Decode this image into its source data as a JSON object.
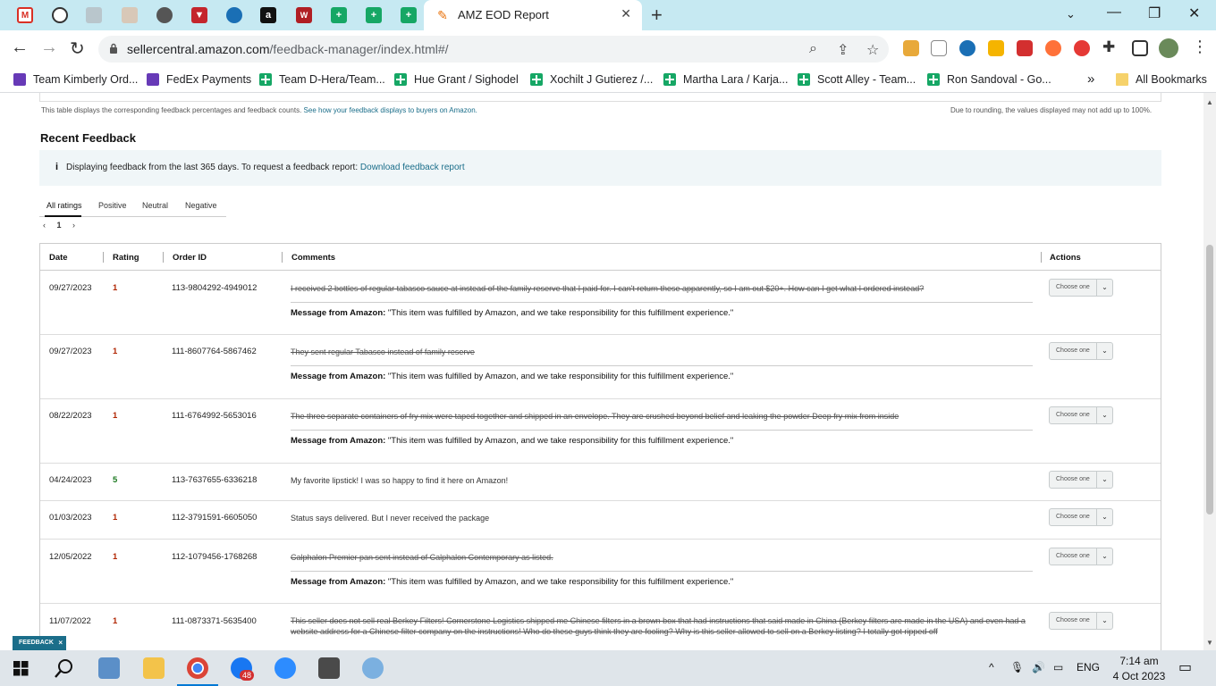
{
  "browser": {
    "active_tab_title": "AMZ EOD Report",
    "url_host": "sellercentral.amazon.com",
    "url_path": "/feedback-manager/index.html#/",
    "bookmarks": [
      "Team Kimberly Ord...",
      "FedEx Payments",
      "Team D-Hera/Team...",
      "Hue Grant / Sighodel",
      "Xochilt J Gutierez /...",
      "Martha Lara / Karja...",
      "Scott Alley - Team...",
      "Ron Sandoval - Go..."
    ],
    "all_bookmarks": "All Bookmarks",
    "overflow": "»"
  },
  "page": {
    "top_note_prefix": "This table displays the corresponding feedback percentages and feedback counts.",
    "top_note_link": "See how your feedback displays to buyers on Amazon.",
    "rounding_note": "Due to rounding, the values displayed may not add up to 100%.",
    "section_title": "Recent Feedback",
    "info_icon": "i",
    "info_text": "Displaying feedback from the last 365 days. To request a feedback report:",
    "info_link": "Download feedback report",
    "rating_tabs": [
      "All ratings",
      "Positive",
      "Neutral",
      "Negative"
    ],
    "pager": {
      "prev": "‹",
      "page": "1",
      "next": "›"
    },
    "columns": [
      "Date",
      "Rating",
      "Order ID",
      "Comments",
      "Actions"
    ],
    "msg_label": "Message from Amazon:",
    "msg_text": "\"This item was fulfilled by Amazon, and we take responsibility for this fulfillment experience.\"",
    "select_placeholder": "Choose one",
    "rows": [
      {
        "date": "09/27/2023",
        "rating": "1",
        "order": "113-9804292-4949012",
        "comment": "I received 2 bottles of regular tabasco sauce at instead of the family reserve that I paid for. I can't return these apparently, so I am out $20+. How can I get what I ordered instead?"
      },
      {
        "date": "09/27/2023",
        "rating": "1",
        "order": "111-8607764-5867462",
        "comment": "They sent regular Tabasco instead of family reserve"
      },
      {
        "date": "08/22/2023",
        "rating": "1",
        "order": "111-6764992-5653016",
        "comment": "The three separate containers of fry mix were taped together and shipped in an envelope. They are crushed beyond belief and leaking the powder Deep fry mix from inside"
      },
      {
        "date": "04/24/2023",
        "rating": "5",
        "order": "113-7637655-6336218",
        "comment": "My favorite lipstick! I was so happy to find it here on Amazon!"
      },
      {
        "date": "01/03/2023",
        "rating": "1",
        "order": "112-3791591-6605050",
        "comment": "Status says delivered. But I never received the package"
      },
      {
        "date": "12/05/2022",
        "rating": "1",
        "order": "112-1079456-1768268",
        "comment": "Calphalon Premier pan sent instead of Calphalon Contemporary as listed."
      },
      {
        "date": "11/07/2022",
        "rating": "1",
        "order": "111-0873371-5635400",
        "comment": "This seller does not sell real Berkey Filters! Cornerstone Logistics shipped me Chinese filters in a brown box that had instructions that said made in China (Berkey filters are made in the USA) and even had a website address for a Chinese filter company on the instructions! Who do these guys think they are fooling? Why is this seller allowed to sell on a Berkey listing? I totally got ripped off"
      }
    ],
    "feedback_button": "FEEDBACK",
    "feedback_close": "×"
  },
  "taskbar": {
    "badge": "48",
    "language": "ENG",
    "time": "7:14 am",
    "date": "4 Oct 2023"
  },
  "colors": {
    "tabbar": "#c6e9f2",
    "link": "#1b6e8a",
    "negative_rating": "#b12704",
    "positive_rating": "#1d7a22"
  }
}
